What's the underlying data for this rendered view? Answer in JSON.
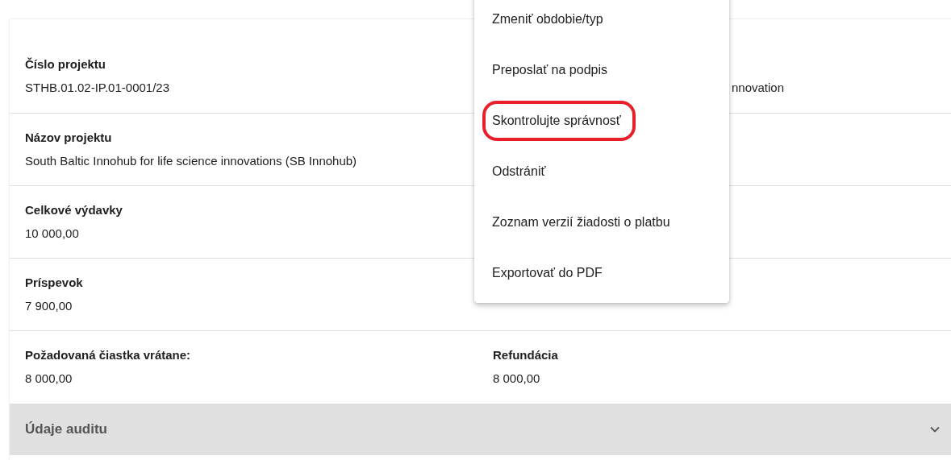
{
  "fields": [
    {
      "label": "Číslo projektu",
      "value": "STHB.01.02-IP.01-0001/23",
      "side_value": "nnovation"
    },
    {
      "label": "Názov projektu",
      "value": "South Baltic Innohub for life science innovations (SB Innohub)"
    },
    {
      "label": "Celkové výdavky",
      "value": "10 000,00"
    },
    {
      "label": "Príspevok",
      "value": "7 900,00"
    },
    {
      "label": "Požadovaná čiastka vrátane:",
      "value": "8 000,00",
      "second": {
        "label": "Refundácia",
        "value": "8 000,00"
      }
    }
  ],
  "section": {
    "title": "Údaje auditu",
    "expanded": false
  },
  "menu": [
    {
      "label": "Zmeniť obdobie/typ",
      "circled": false
    },
    {
      "label": "Preposlať na podpis",
      "circled": false
    },
    {
      "label": "Skontrolujte správnosť",
      "circled": true
    },
    {
      "label": "Odstrániť",
      "circled": false
    },
    {
      "label": "Zoznam verzií žiadosti o platbu",
      "circled": false
    },
    {
      "label": "Exportovať do PDF",
      "circled": false
    }
  ]
}
